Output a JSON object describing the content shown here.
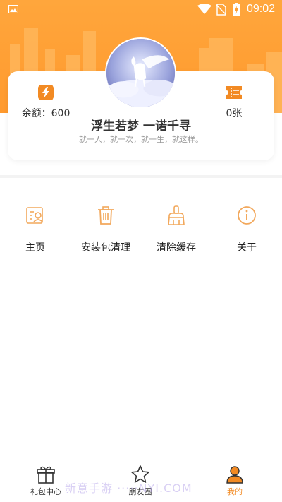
{
  "status_bar": {
    "time": "09:02"
  },
  "profile": {
    "balance_label": "余额：600",
    "tickets_label": "0张",
    "username": "浮生若梦 一诺千寻",
    "signature": "就一人，就一次，就一生，就这样。"
  },
  "menu": {
    "items": [
      {
        "label": "主页",
        "icon": "profile-card-icon"
      },
      {
        "label": "安装包清理",
        "icon": "trash-icon"
      },
      {
        "label": "清除缓存",
        "icon": "broom-icon"
      },
      {
        "label": "关于",
        "icon": "info-icon"
      }
    ]
  },
  "bottom_nav": {
    "items": [
      {
        "label": "礼包中心",
        "icon": "gift-icon"
      },
      {
        "label": "朋友圈",
        "icon": "star-icon"
      },
      {
        "label": "我的",
        "icon": "user-icon",
        "active": true
      }
    ]
  },
  "watermark": "新意手游 ·····NYI.COM",
  "colors": {
    "accent": "#f28a23",
    "header": "#ffa63c"
  }
}
